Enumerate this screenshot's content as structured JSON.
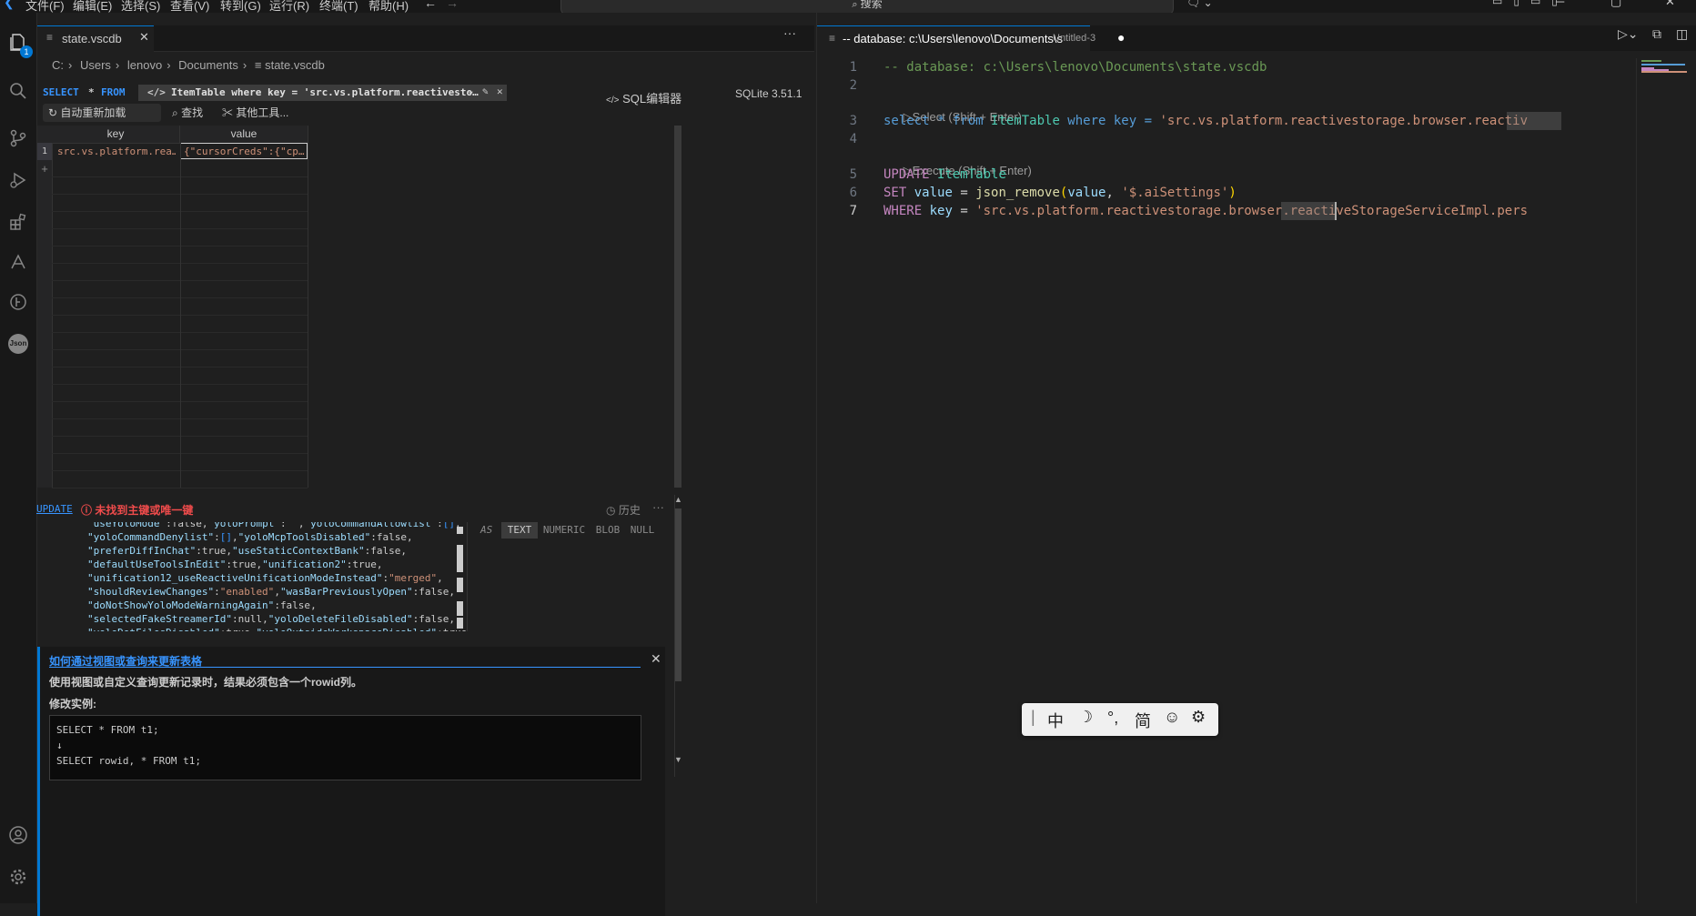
{
  "menu": {
    "items": [
      "文件(F)",
      "编辑(E)",
      "选择(S)",
      "查看(V)",
      "转到(G)",
      "运行(R)",
      "终端(T)",
      "帮助(H)"
    ],
    "search_placeholder": "搜索"
  },
  "activity": {
    "badge": "1"
  },
  "left_tab": {
    "title": "state.vscdb"
  },
  "breadcrumb": [
    "C:",
    "Users",
    "lenovo",
    "Documents",
    "state.vscdb"
  ],
  "query_bar": {
    "select_kw": "SELECT",
    "star": "*",
    "from_kw": "FROM",
    "query_text": "ItemTable where key = 'src.vs.platform.reactivesto…",
    "sql_editor_label": "SQL编辑器",
    "version": "SQLite 3.51.1"
  },
  "toolbar": {
    "reload_label": "自动重新加载",
    "find_label": "查找",
    "tools_label": "其他工具..."
  },
  "table": {
    "columns": [
      "key",
      "value"
    ],
    "rows": [
      {
        "num": "1",
        "key": "src.vs.platform.rea…",
        "value": "{\"cursorCreds\":{\"cp…"
      }
    ],
    "add_row": "+"
  },
  "update_panel": {
    "update_label": "UPDATE",
    "warning": "未找到主键或唯一键",
    "history_label": "历史",
    "json_lines": [
      "\"useYoloMode\":false,\"yoloPrompt\":\"\",\"yoloCommandAllowlist\":[],",
      "\"yoloCommandDenylist\":[],\"yoloMcpToolsDisabled\":false,",
      "\"preferDiffInChat\":true,\"useStaticContextBank\":false,",
      "\"defaultUseToolsInEdit\":true,\"unification2\":true,",
      "\"unification12_useReactiveUnificationModeInstead\":\"merged\",",
      "\"shouldReviewChanges\":\"enabled\",\"wasBarPreviouslyOpen\":false,",
      "\"doNotShowYoloModeWarningAgain\":false,",
      "\"selectedFakeStreamerId\":null,\"yoloDeleteFileDisabled\":false,",
      "\"yoloDotFilesDisabled\":true,\"yoloOutsideWorkspaceDisabled\":true"
    ],
    "as_label": "AS",
    "types": [
      "TEXT",
      "NUMERIC",
      "BLOB",
      "NULL"
    ],
    "selected_type": "TEXT"
  },
  "help_box": {
    "title": "如何通过视图或查询来更新表格",
    "desc": "使用视图或自定义查询更新记录时，结果必须包含一个rowid列。",
    "example_label": "修改实例:",
    "code_line1": "SELECT * FROM t1;",
    "arrow": "↓",
    "code_line2": "SELECT rowid, * FROM t1;"
  },
  "right_tab": {
    "title": "-- database: c:\\Users\\lenovo\\Documents\\s",
    "subtitle": "Untitled-3"
  },
  "editor": {
    "line_numbers": [
      "1",
      "2",
      "3",
      "4",
      "5",
      "6",
      "7"
    ],
    "line1": "-- database: c:\\Users\\lenovo\\Documents\\state.vscdb",
    "codelens_select": "Select (Shift + Enter)",
    "line3_a": "select * from ",
    "line3_tbl": "ItemTable",
    "line3_b": " where key = ",
    "line3_str": "'src.vs.platform.reactivestorage.browser.reactiv",
    "codelens_execute": "Execute (Shift + Enter)",
    "line5_kw": "UPDATE",
    "line5_tbl": "ItemTable",
    "line6_kw": "SET",
    "line6_id": "value",
    "line6_fn": "json_remove",
    "line6_arg": "value",
    "line6_str": "'$.aiSettings'",
    "line7_kw": "WHERE",
    "line7_id": "key",
    "line7_str": "'src.vs.platform.reactivestorage.browser.reactiveStorageServiceImpl.pers"
  },
  "ime": {
    "chars": [
      "中",
      "°,",
      "简"
    ]
  }
}
